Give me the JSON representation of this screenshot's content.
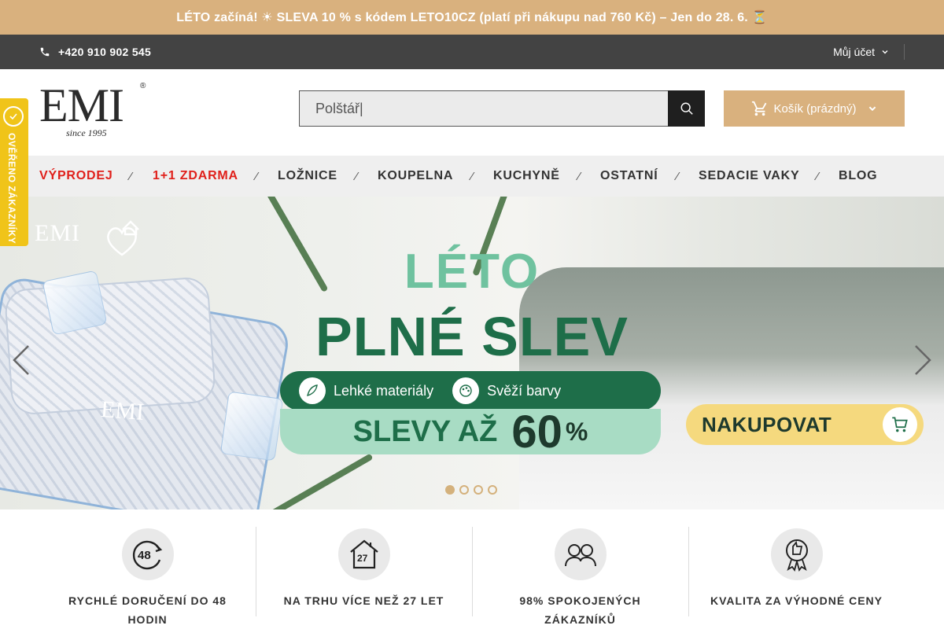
{
  "promo": {
    "text": "LÉTO začíná! ☀ SLEVA 10 % s kódem LETO10CZ (platí při nákupu nad 760 Kč) – Jen do 28. 6. ⏳"
  },
  "topbar": {
    "phone": "+420 910 902 545",
    "account_label": "Můj účet"
  },
  "logo": {
    "text": "EMI",
    "reg": "®",
    "since": "since 1995"
  },
  "search": {
    "value": "Polštář|"
  },
  "cart": {
    "label": "Košík (prázdný)"
  },
  "verified": {
    "label": "OVĚŘENO ZÁKAZNÍKY"
  },
  "nav": [
    {
      "label": "VÝPRODEJ"
    },
    {
      "label": "1+1 ZDARMA"
    },
    {
      "label": "LOŽNICE"
    },
    {
      "label": "KOUPELNA"
    },
    {
      "label": "KUCHYNĚ"
    },
    {
      "label": "OSTATNÍ"
    },
    {
      "label": "SEDACIE VAKY"
    },
    {
      "label": "BLOG"
    }
  ],
  "nav_separator": "⁄",
  "hero": {
    "logo": "EMI",
    "pillow_logo": "EMI",
    "title_line1": "LÉTO",
    "title_line2": "PLNÉ SLEV",
    "tag1": "Lehké materiály",
    "tag2": "Svěží barvy",
    "discount_text": "SLEVY AŽ",
    "discount_value": "60",
    "discount_unit": "%",
    "cta": "NAKUPOVAT",
    "slides_total": 4,
    "slide_active": 1
  },
  "features": [
    {
      "icon": "48",
      "text": "RYCHLÉ DORUČENÍ DO 48 HODIN"
    },
    {
      "icon": "27",
      "text": "NA TRHU VÍCE NEŽ 27 LET"
    },
    {
      "icon": "customers",
      "text": "98% SPOKOJENÝCH ZÁKAZNÍKŮ"
    },
    {
      "icon": "quality",
      "text": "KVALITA ZA VÝHODNÉ CENY"
    }
  ],
  "colors": {
    "gold": "#d9b17e",
    "dark": "#434343",
    "sale_red": "#e0201b",
    "hero_green": "#1e6e49",
    "hero_mint": "#6fc29f"
  }
}
